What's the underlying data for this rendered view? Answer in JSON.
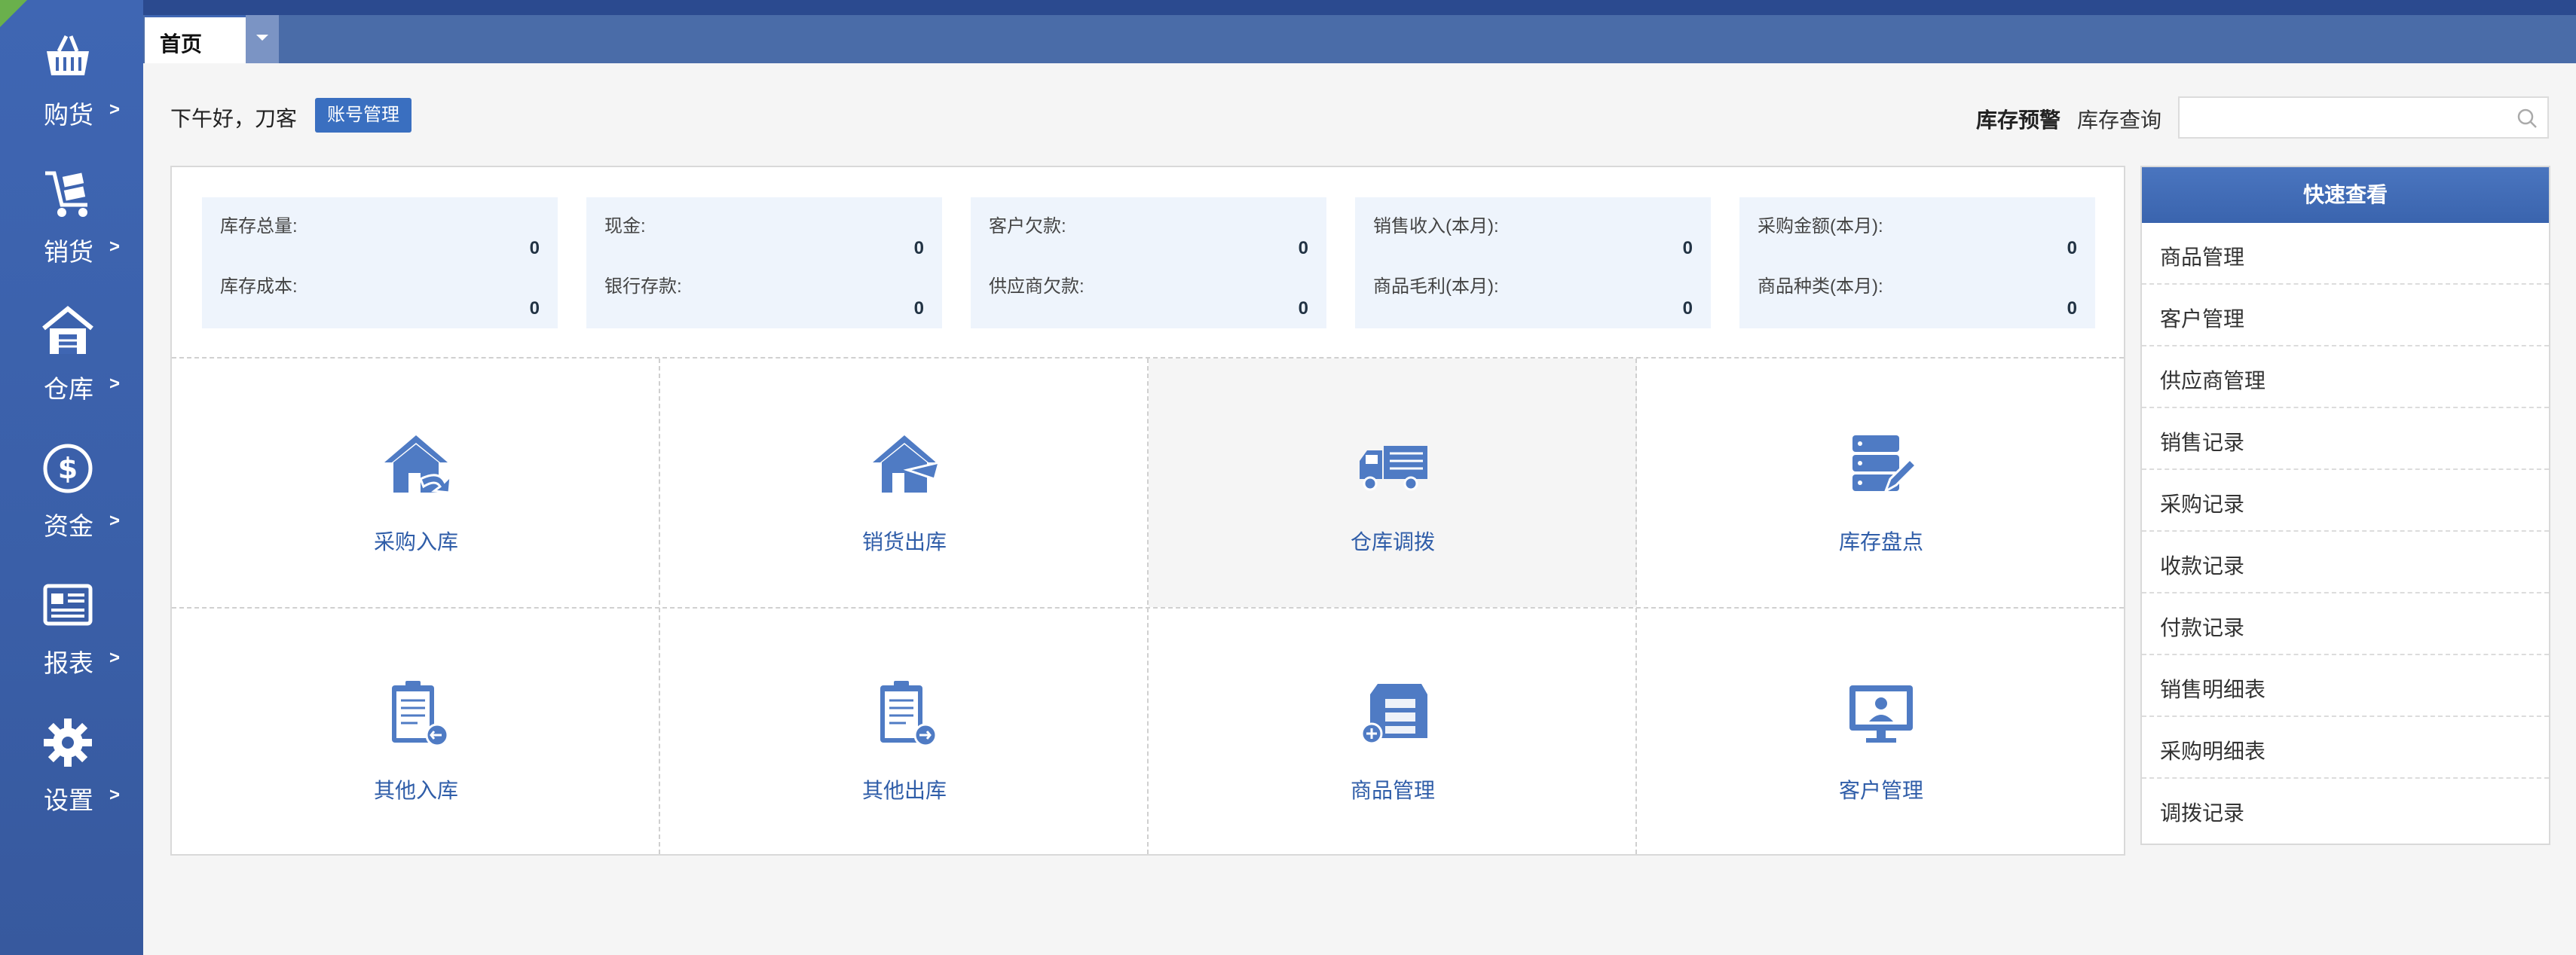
{
  "sidebar": {
    "items": [
      {
        "label": "购货",
        "icon": "basket-icon"
      },
      {
        "label": "销货",
        "icon": "handcart-icon"
      },
      {
        "label": "仓库",
        "icon": "warehouse-icon"
      },
      {
        "label": "资金",
        "icon": "dollar-icon"
      },
      {
        "label": "报表",
        "icon": "report-icon"
      },
      {
        "label": "设置",
        "icon": "gear-icon"
      }
    ],
    "chevron": ">"
  },
  "tabs": {
    "active_label": "首页"
  },
  "header": {
    "greeting": "下午好，刀客",
    "account_button": "账号管理",
    "stock_warning": "库存预警",
    "stock_query": "库存查询",
    "search_placeholder": ""
  },
  "stats": [
    {
      "label1": "库存总量:",
      "value1": "0",
      "label2": "库存成本:",
      "value2": "0"
    },
    {
      "label1": "现金:",
      "value1": "0",
      "label2": "银行存款:",
      "value2": "0"
    },
    {
      "label1": "客户欠款:",
      "value1": "0",
      "label2": "供应商欠款:",
      "value2": "0"
    },
    {
      "label1": "销售收入(本月):",
      "value1": "0",
      "label2": "商品毛利(本月):",
      "value2": "0"
    },
    {
      "label1": "采购金额(本月):",
      "value1": "0",
      "label2": "商品种类(本月):",
      "value2": "0"
    }
  ],
  "shortcuts": [
    {
      "label": "采购入库",
      "icon": "house-inbound-icon"
    },
    {
      "label": "销货出库",
      "icon": "house-outbound-icon"
    },
    {
      "label": "仓库调拨",
      "icon": "truck-icon"
    },
    {
      "label": "库存盘点",
      "icon": "server-edit-icon"
    },
    {
      "label": "其他入库",
      "icon": "clipboard-in-icon"
    },
    {
      "label": "其他出库",
      "icon": "clipboard-out-icon"
    },
    {
      "label": "商品管理",
      "icon": "cabinet-add-icon"
    },
    {
      "label": "客户管理",
      "icon": "monitor-user-icon"
    }
  ],
  "quick": {
    "title": "快速查看",
    "items": [
      "商品管理",
      "客户管理",
      "供应商管理",
      "销售记录",
      "采购记录",
      "收款记录",
      "付款记录",
      "销售明细表",
      "采购明细表",
      "调拨记录"
    ]
  },
  "colors": {
    "accent": "#3f66b3",
    "icon_blue": "#4f7bc4",
    "label_blue": "#2f5da8"
  }
}
